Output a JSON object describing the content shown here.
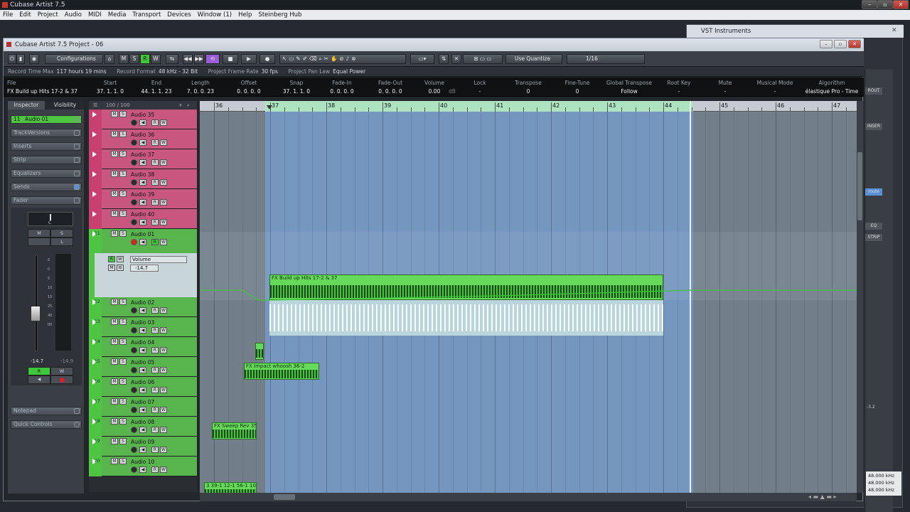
{
  "app_title": "Cubase Artist 7.5",
  "menu": [
    "File",
    "Edit",
    "Project",
    "Audio",
    "MIDI",
    "Media",
    "Transport",
    "Devices",
    "Window (1)",
    "Help",
    "Steinberg Hub"
  ],
  "vst_window": {
    "title": "VST Instruments",
    "tags": [
      "ROUT",
      "INSER",
      "mute",
      "EQ",
      "STRIP"
    ],
    "rates": [
      "48.000 kHz",
      "48.000 kHz",
      "48.000 kHz"
    ],
    "mini_vals": [
      "-3.2"
    ]
  },
  "project": {
    "title": "Cubase Artist 7.5 Project - 06",
    "toolbar": {
      "configurations": "Configurations",
      "mode_m": "M",
      "mode_s": "S",
      "mode_r": "R",
      "mode_w": "W",
      "use_quantize": "Use Quantize",
      "quantize": "1/16"
    },
    "status": [
      {
        "label": "Record Time Max",
        "value": "117 hours 19 mins"
      },
      {
        "label": "Record Format",
        "value": "48 kHz - 32 Bit"
      },
      {
        "label": "Project Frame Rate",
        "value": "30 fps"
      },
      {
        "label": "Project Pan Law",
        "value": "Equal Power"
      }
    ],
    "infoline": {
      "file_label": "File",
      "file_value": "FX Build up Hits 17-2 & 37",
      "columns": [
        {
          "h": "Start",
          "v": "37. 1. 1.    0"
        },
        {
          "h": "End",
          "v": "44. 1. 1.  23"
        },
        {
          "h": "Length",
          "v": "7. 0. 0.  23"
        },
        {
          "h": "Offset",
          "v": "0. 0. 0.    0"
        },
        {
          "h": "Snap",
          "v": "37. 1. 1.    0"
        },
        {
          "h": "Fade-In",
          "v": "0. 0. 0.    0"
        },
        {
          "h": "Fade-Out",
          "v": "0. 0. 0.    0"
        },
        {
          "h": "Volume",
          "v": "0.00"
        },
        {
          "h": "Lock",
          "v": "-"
        },
        {
          "h": "Transpose",
          "v": "0"
        },
        {
          "h": "Fine-Tune",
          "v": "0"
        },
        {
          "h": "Global Transpose",
          "v": "Follow"
        },
        {
          "h": "Root Key",
          "v": "-"
        },
        {
          "h": "Mute",
          "v": "-"
        },
        {
          "h": "Musical Mode",
          "v": "-"
        },
        {
          "h": "Algorithm",
          "v": "élastique Pro - Time"
        }
      ],
      "volume_unit": "dB"
    },
    "inspector": {
      "tabs": [
        "Inspector",
        "Visibility"
      ],
      "track_name": "Audio 01",
      "track_num": "11",
      "sections": [
        "TrackVersions",
        "Inserts",
        "Strip",
        "Equalizers",
        "Sends",
        "Fader"
      ],
      "lower_sections": [
        "Notepad",
        "Quick Controls"
      ],
      "pan": "C",
      "fader_left": "-14.7",
      "fader_right": "-14.9",
      "scale": [
        "6",
        "0",
        "5",
        "10",
        "15",
        "25",
        "40",
        "00"
      ]
    },
    "tracklist_header": "100 / 100",
    "tracks": [
      {
        "name": "Audio 35",
        "num": "",
        "color": "#c7406f"
      },
      {
        "name": "Audio 36",
        "num": "",
        "color": "#c7406f"
      },
      {
        "name": "Audio 37",
        "num": "",
        "color": "#c7406f"
      },
      {
        "name": "Audio 38",
        "num": "",
        "color": "#c7406f"
      },
      {
        "name": "Audio 39",
        "num": "",
        "color": "#c7406f"
      },
      {
        "name": "Audio 40",
        "num": "",
        "color": "#c7406f"
      },
      {
        "name": "Audio 01",
        "num": "11",
        "color": "#4fc443"
      },
      {
        "name": "Audio 02",
        "num": "12",
        "color": "#4fc443"
      },
      {
        "name": "Audio 03",
        "num": "13",
        "color": "#4fc443"
      },
      {
        "name": "Audio 04",
        "num": "14",
        "color": "#4fc443"
      },
      {
        "name": "Audio 05",
        "num": "15",
        "color": "#4fc443"
      },
      {
        "name": "Audio 06",
        "num": "16",
        "color": "#4fc443"
      },
      {
        "name": "Audio 07",
        "num": "17",
        "color": "#4fc443"
      },
      {
        "name": "Audio 08",
        "num": "18",
        "color": "#4fc443"
      },
      {
        "name": "Audio 09",
        "num": "19",
        "color": "#4fc443"
      },
      {
        "name": "Audio 10",
        "num": "20",
        "color": "#4fc443"
      }
    ],
    "automation": {
      "param": "Volume",
      "value": "-14.7"
    },
    "ruler": [
      "36",
      "37",
      "38",
      "39",
      "40",
      "41",
      "42",
      "43",
      "44",
      "45",
      "46",
      "47"
    ],
    "clips": [
      {
        "name": "FX Build up Hits 17-2 & 37",
        "track": 6
      },
      {
        "name": "FX Impact whoosh 36-2",
        "track": 8
      },
      {
        "name": "FX Sweep Rev 35",
        "track": 11
      },
      {
        "name": "3 39-1 12-1 56-1 100-",
        "track": 14
      },
      {
        "name": "FX Whoosh up 35-3 39-1 12-1 56-1 100-1",
        "track": 15
      }
    ]
  }
}
